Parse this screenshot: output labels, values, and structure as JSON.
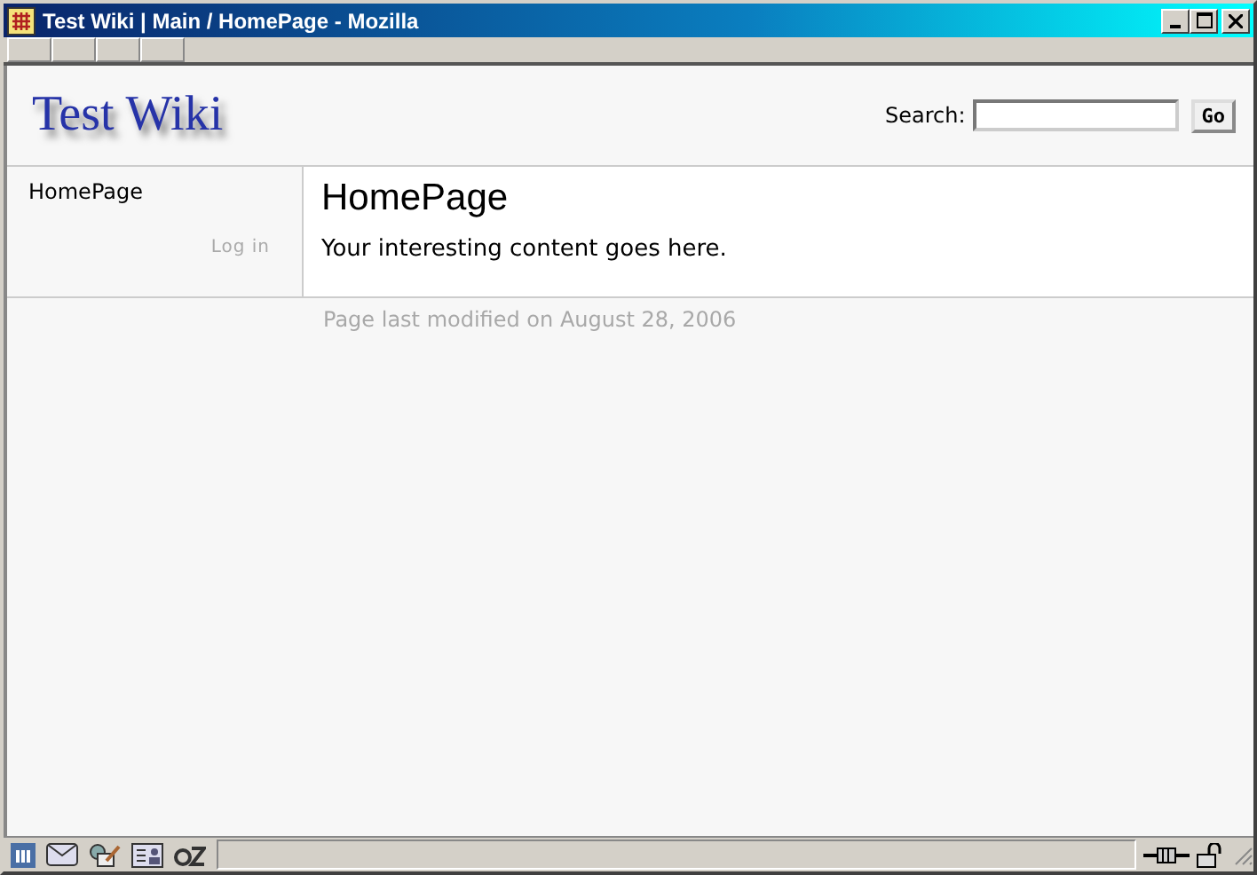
{
  "window": {
    "title": "Test Wiki | Main / HomePage - Mozilla"
  },
  "header": {
    "site_title": "Test Wiki",
    "search_label": "Search:",
    "search_button": "Go"
  },
  "sidebar": {
    "items": [
      "HomePage"
    ],
    "login": "Log in"
  },
  "page": {
    "heading": "HomePage",
    "content": "Your interesting content goes here.",
    "last_modified": "Page last modified on August 28, 2006"
  }
}
